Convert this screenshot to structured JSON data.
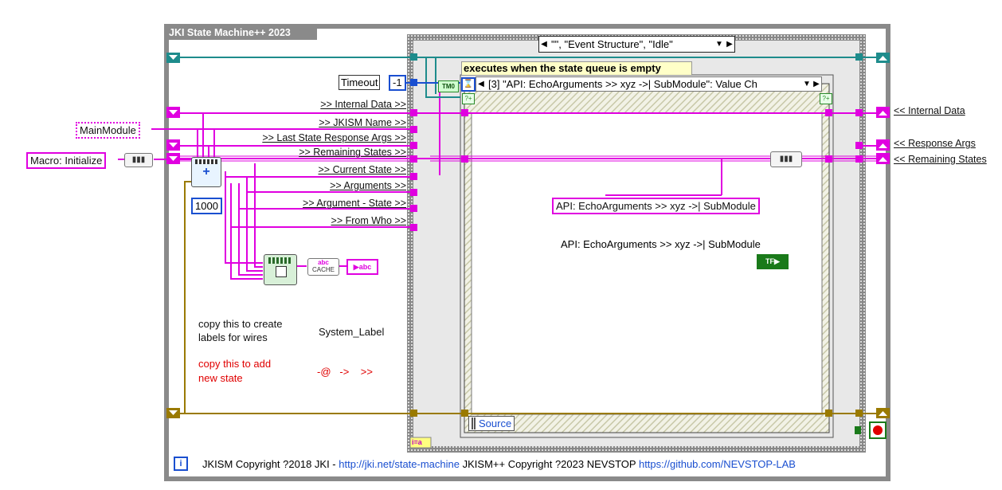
{
  "outer_loop": {
    "title": "JKI State Machine++ 2023",
    "footer_icon": "info-icon",
    "footer_prefix": "JKISM Copyright ?2018 JKI - ",
    "footer_link1": "http://jki.net/state-machine",
    "footer_middle": " JKISM++ Copyright ?2023 NEVSTOP ",
    "footer_link2": "https://github.com/NEVSTOP-LAB"
  },
  "left_inputs": {
    "main_module": "MainModule",
    "macro": "Macro: Initialize"
  },
  "shift_register_labels": [
    ">> Internal Data >>",
    ">> JKISM Name >>",
    ">> Last State Response Args >>",
    ">> Remaining States >>",
    ">> Current State >>",
    ">> Arguments >>",
    ">> Argument - State >>",
    ">> From Who >>"
  ],
  "timeout": {
    "label": "Timeout",
    "value": "-1"
  },
  "constant_1000": "1000",
  "cache_label": "CACHE",
  "abc_label": "abc",
  "notes": {
    "labels_note_line1": "copy this to create",
    "labels_note_line2": "labels for wires",
    "system_label": "System_Label",
    "new_state_line1": "copy this to add",
    "new_state_line2": "new state",
    "state_syntax": "-@   ->    >>"
  },
  "case_structure": {
    "selector": "\"\", \"Event Structure\", \"Idle\"",
    "subdiagram_label": "executes when the state queue is empty",
    "iteration_terminal": "i=a"
  },
  "event_structure": {
    "selector": "[3] \"API: EchoArguments >> xyz ->| SubModule\": Value Ch",
    "timeout_terminal": "TM0",
    "source_label": "Source",
    "string_constant": "API: EchoArguments >> xyz ->| SubModule",
    "control_label": "API: EchoArguments >> xyz ->| SubModule",
    "bool_constant": "TF"
  },
  "right_outputs": [
    "<< Internal Data",
    "<< Response Args",
    "<< Remaining States"
  ],
  "colors": {
    "wire_pink": "#e000e0",
    "wire_cluster": "#9a7a00",
    "wire_blue": "#1a4fd0",
    "wire_teal": "#1e8c8c",
    "while_border": "#808080",
    "case_border": "#555555"
  }
}
